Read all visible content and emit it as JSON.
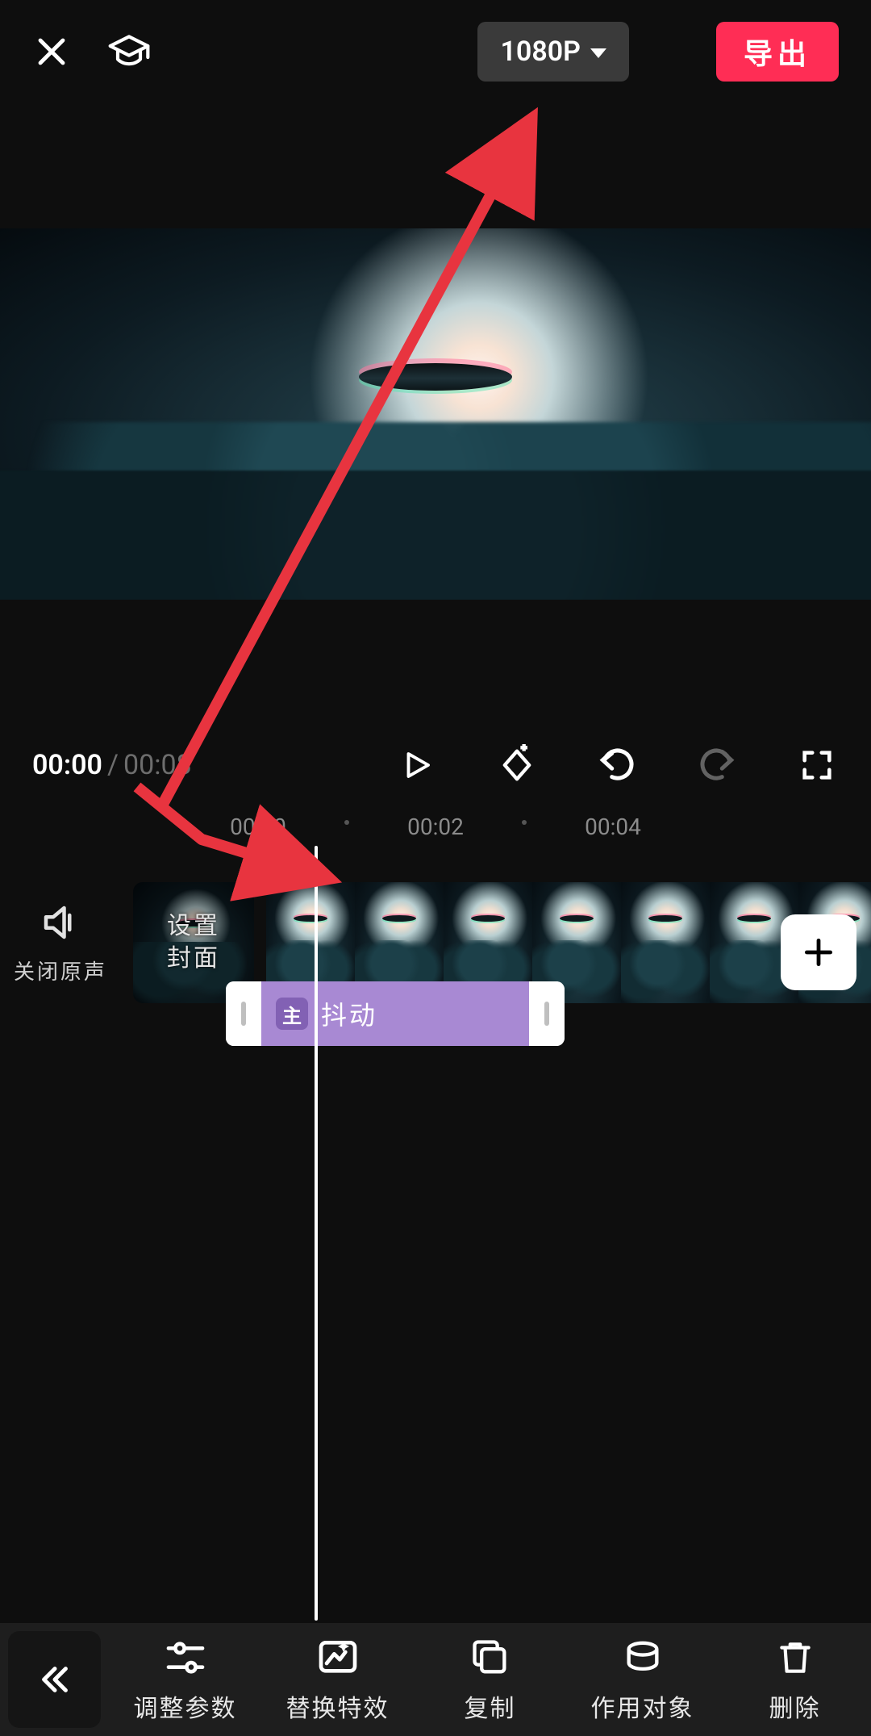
{
  "header": {
    "resolution": "1080P",
    "export": "导出"
  },
  "player": {
    "current_time": "00:00",
    "total_time": "00:08"
  },
  "timeline": {
    "ticks": [
      "00:00",
      "00:02",
      "00:04"
    ],
    "mute_label": "关闭原声",
    "cover_label_1": "设置",
    "cover_label_2": "封面",
    "effect_badge": "主",
    "effect_name": "抖动"
  },
  "toolbar": {
    "adjust": "调整参数",
    "replace": "替换特效",
    "copy": "复制",
    "target": "作用对象",
    "delete": "删除"
  }
}
